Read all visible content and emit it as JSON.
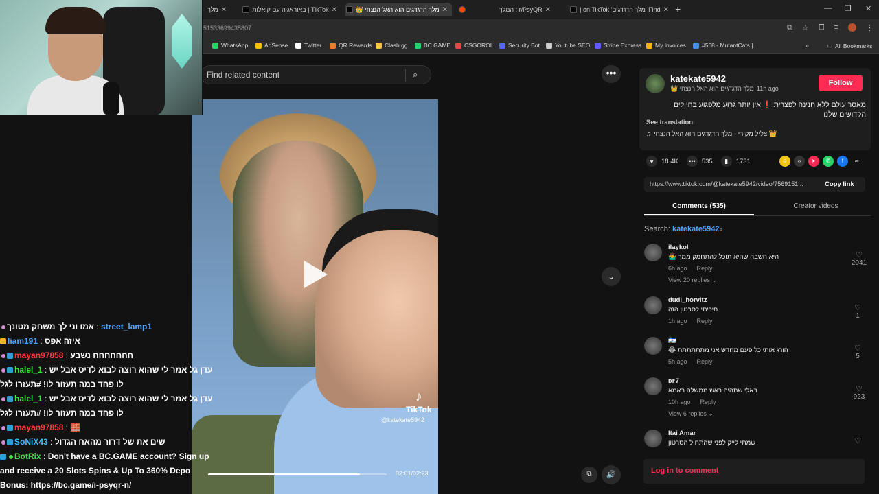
{
  "browser": {
    "tabs": [
      {
        "label": "מלך"
      },
      {
        "label": "TikTok | באוראגיה עם קואלות"
      },
      {
        "label": "מלך הדגדגים הוא האל הנצחי 👑"
      },
      {
        "label": ""
      },
      {
        "label": "r/PsyQR : המלך"
      },
      {
        "label": "Find 'מלך הדגדגים' on TikTok |"
      }
    ],
    "url": "51533699435807",
    "bookmarks": [
      {
        "label": "WhatsApp",
        "color": "#25d366"
      },
      {
        "label": "AdSense",
        "color": "#fbbc04"
      },
      {
        "label": "Twitter",
        "color": "#ffffff"
      },
      {
        "label": "QR Rewards",
        "color": "#e57c3a"
      },
      {
        "label": "Clash.gg",
        "color": "#f6c343"
      },
      {
        "label": "BC.GAME",
        "color": "#2ecc71"
      },
      {
        "label": "CSGOROLL",
        "color": "#e84545"
      },
      {
        "label": "Security Bot",
        "color": "#5865f2"
      },
      {
        "label": "Youtube SEO",
        "color": "#cccccc"
      },
      {
        "label": "Stripe Express",
        "color": "#635bff"
      },
      {
        "label": "My Invoices",
        "color": "#f4b400"
      },
      {
        "label": "#568 - MutantCats |...",
        "color": "#4a90e2"
      }
    ],
    "all_bookmarks": "All Bookmarks",
    "more_bookmarks": "»"
  },
  "video": {
    "search_placeholder": "Find related content",
    "tiktok_label": "TikTok",
    "watermark_user": "@katekate5942",
    "time": "02:01/02:23",
    "progress": 0.85
  },
  "chat": [
    {
      "user": "street_lamp1",
      "user_color": "u-blue",
      "text": "אמו וני לך משחק מטונך"
    },
    {
      "user": "liam191",
      "user_color": "u-blue",
      "text": "איזה אפס"
    },
    {
      "user": "mayan97858",
      "user_color": "u-red",
      "text": "חחחחחחח נשבע"
    },
    {
      "user": "halel_1",
      "user_color": "u-green",
      "text": "עדן גל אמר לי שהוא רוצה לבוא לדיס אבל יש לו פחד במה תעזור לו! #תעזרו לגל"
    },
    {
      "user": "halel_1",
      "user_color": "u-green",
      "text": "עדן גל אמר לי שהוא רוצה לבוא לדיס אבל יש לו פחד במה תעזור לו! #תעזרו לגל"
    },
    {
      "user": "mayan97858",
      "user_color": "u-red",
      "text": "🧱"
    },
    {
      "user": "SoNiX43",
      "user_color": "u-cyan",
      "text": "שים את של דרור מהאח הגדול"
    },
    {
      "user": "BotRix",
      "user_color": "u-green",
      "text": "Don't have a BC.GAME account? Sign up and receive a 20 Slots Spins & Up To 360% Depo Bonus: https://bc.game/i-psyqr-n/"
    }
  ],
  "post": {
    "author": "katekate5942",
    "sound_title": "מלך הדגדגים הוא האל הנצחי 👑",
    "time_ago": "11h ago",
    "follow": "Follow",
    "caption": "מאסר עולם ללא חנינה לפצרית ❗ אין יותר גרוע מלפגוע בחיילים הקדושים שלנו",
    "see_translation": "See translation",
    "music": "צליל מקורי - מלך הדגדגים הוא האל הנצחי 👑",
    "likes": "18.4K",
    "comments_count": "535",
    "saves": "1731",
    "link": "https://www.tiktok.com/@katekate5942/video/7569151...",
    "copy_link": "Copy link",
    "tab_comments": "Comments (535)",
    "tab_creator": "Creator videos",
    "search_label": "Search:",
    "search_term": "katekate5942",
    "login": "Log in to comment"
  },
  "comments": [
    {
      "user": "ilaykol",
      "text": "היא חשבה שהיא תוכל להתחמק ממך 🤷‍♂️",
      "time": "6h ago",
      "reply": "Reply",
      "likes": "2041",
      "view_replies": "View 20 replies ⌄"
    },
    {
      "user": "dudi_horvitz",
      "text": "חיכיתי לסרטון הזה",
      "time": "1h ago",
      "reply": "Reply",
      "likes": "1",
      "view_replies": ""
    },
    {
      "user": "🇮🇱",
      "text": "הורג אותי כל פעם מחדש אני מתתתתתת 😂",
      "time": "5h ago",
      "reply": "Reply",
      "likes": "5",
      "view_replies": ""
    },
    {
      "user": "ᴅꜰ7",
      "text": "באלי שתהיה ראש ממשלה באמא",
      "time": "10h ago",
      "reply": "Reply",
      "likes": "923",
      "view_replies": "View 6 replies ⌄"
    },
    {
      "user": "Itai Amar",
      "text": "שמתי לייק לפני שהתחיל הסרטון",
      "time": "",
      "reply": "",
      "likes": "",
      "view_replies": ""
    }
  ]
}
